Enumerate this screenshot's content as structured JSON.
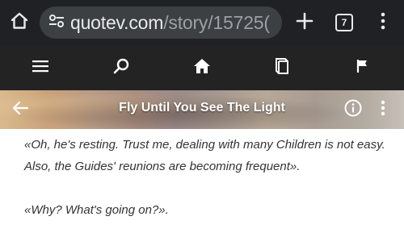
{
  "browser": {
    "url_host": "quotev.com",
    "url_path": "/story/15725(",
    "tab_count": "7",
    "icons": {
      "home": "home-icon",
      "site_settings": "tune-icon",
      "new_tab": "plus-icon",
      "tabs": "tab-switcher-icon",
      "menu": "more-vert-icon"
    }
  },
  "site_nav": {
    "items": [
      {
        "name": "menu",
        "icon": "hamburger-menu-icon"
      },
      {
        "name": "search",
        "icon": "search-icon"
      },
      {
        "name": "home",
        "icon": "home-icon"
      },
      {
        "name": "library",
        "icon": "book-icon"
      },
      {
        "name": "notifications",
        "icon": "flag-icon"
      }
    ]
  },
  "story_bar": {
    "title": "Fly Until You See The Light",
    "icons": {
      "back": "arrow-left-icon",
      "info": "info-icon",
      "more": "more-vert-icon"
    }
  },
  "story": {
    "paragraphs": [
      {
        "lines": [
          "«Oh, he's resting. Trust me, dealing with many Children is not easy.",
          "Also, the Guides' reunions are becoming frequent»."
        ]
      },
      {
        "lines": [
          "«Why? What's going on?»."
        ]
      }
    ]
  },
  "colors": {
    "browser_bg": "#202124",
    "url_pill_bg": "#3c4043",
    "nav_bg": "#232323",
    "icon_color": "#ffffff",
    "text_color": "#333333"
  }
}
